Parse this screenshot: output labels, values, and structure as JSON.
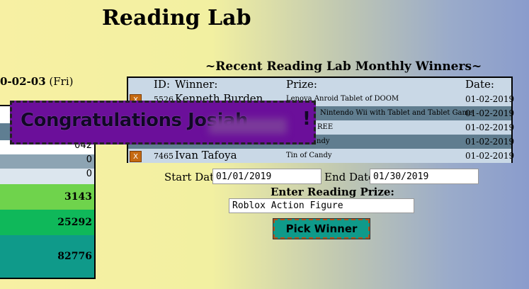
{
  "page": {
    "title": "Reading Lab",
    "date_bold": "0-02-03",
    "date_day": "(Fri)"
  },
  "stats": [
    {
      "value": "",
      "bg": "#ffffff"
    },
    {
      "value": "",
      "bg": "#5f7e92"
    },
    {
      "value": "042",
      "bg": "#ffffff"
    },
    {
      "value": "0",
      "bg": "#8da4b3"
    },
    {
      "value": "0",
      "bg": "#dce6ee"
    },
    {
      "value": "3143",
      "bg": "#6fd34c"
    },
    {
      "value": "25292",
      "bg": "#0fb85a"
    },
    {
      "value": "82776",
      "bg": "#0f9a8a"
    }
  ],
  "winners": {
    "title": "~Recent Reading Lab Monthly Winners~",
    "headers": {
      "id": "ID:",
      "winner": "Winner:",
      "prize": "Prize:",
      "date": "Date:"
    },
    "delete_label": "X",
    "rows": [
      {
        "id": "5526",
        "name": "Kenneth Burden",
        "prize": "Lenova Anroid Tablet of DOOM",
        "date": "01-02-2019",
        "bg": "#c9d8e6"
      },
      {
        "id": "",
        "name": "",
        "prize": "Nintendo Wii with Tablet and Tablet Game",
        "date": "01-02-2019",
        "bg": "#607d8f"
      },
      {
        "id": "",
        "name": "",
        "prize": "REE",
        "date": "01-02-2019",
        "bg": "#c9d8e6"
      },
      {
        "id": "",
        "name": "",
        "prize": "ndy",
        "date": "01-02-2019",
        "bg": "#607d8f"
      },
      {
        "id": "7465",
        "name": "Ivan Tafoya",
        "prize": "Tin of Candy",
        "date": "01-02-2019",
        "bg": "#c9d8e6"
      }
    ]
  },
  "banner": {
    "text": "Congratulations Josiah",
    "bang": "!",
    "color": "#6b0f9a"
  },
  "form": {
    "start_label": "Start Date",
    "start_value": "01/01/2019",
    "end_label": "End Date",
    "end_value": "01/30/2019",
    "prize_label": "Enter Reading Prize:",
    "prize_value": "Roblox Action Figure",
    "pick_button": "Pick Winner"
  }
}
